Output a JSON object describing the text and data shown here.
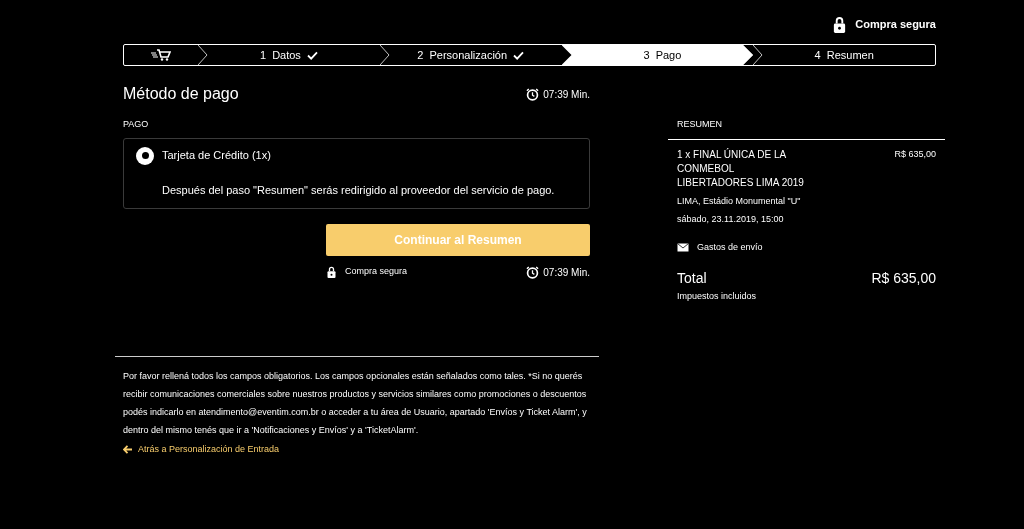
{
  "header": {
    "secure_label": "Compra segura"
  },
  "steps": [
    {
      "number": "1",
      "label": "Datos",
      "done": true,
      "selected": false
    },
    {
      "number": "2",
      "label": "Personalización",
      "done": true,
      "selected": false
    },
    {
      "number": "3",
      "label": "Pago",
      "done": false,
      "selected": true
    },
    {
      "number": "4",
      "label": "Resumen",
      "done": false,
      "selected": false
    }
  ],
  "payment": {
    "title": "Método de pago",
    "timer": "07:39 Min.",
    "section_label": "PAGO",
    "options": [
      {
        "label": "Tarjeta de Crédito (1x)",
        "selected": true,
        "note": "Después del paso \"Resumen\" serás redirigido al proveedor del servicio de pago."
      }
    ],
    "continue_button": "Continuar al Resumen",
    "secure_label": "Compra segura",
    "timer_bottom": "07:39 Min."
  },
  "footer": {
    "notice": "Por favor rellená todos los campos obligatorios. Los campos opcionales están señalados como tales. *Si no querés recibir comunicaciones comerciales sobre nuestros productos y servicios similares como promociones o descuentos podés indicarlo en atendimento@eventim.com.br o acceder a tu área de Usuario, apartado 'Envíos y Ticket Alarm', y dentro del mismo tenés que ir a 'Notificaciones y Envíos' y a 'TicketAlarm'.",
    "back_link": "Atrás a Personalización de Entrada"
  },
  "summary": {
    "title": "RESUMEN",
    "item_lines": [
      "1 x FINAL ÚNICA DE LA",
      "CONMEBOL",
      "LIBERTADORES LIMA 2019"
    ],
    "item_price": "R$ 635,00",
    "venue": "LIMA, Estádio Monumental \"U\"",
    "date": "sábado, 23.11.2019, 15:00",
    "shipping": "Gastos de envío",
    "total_label": "Total",
    "total": "R$ 635,00",
    "tax_note": "Impuestos incluidos"
  }
}
